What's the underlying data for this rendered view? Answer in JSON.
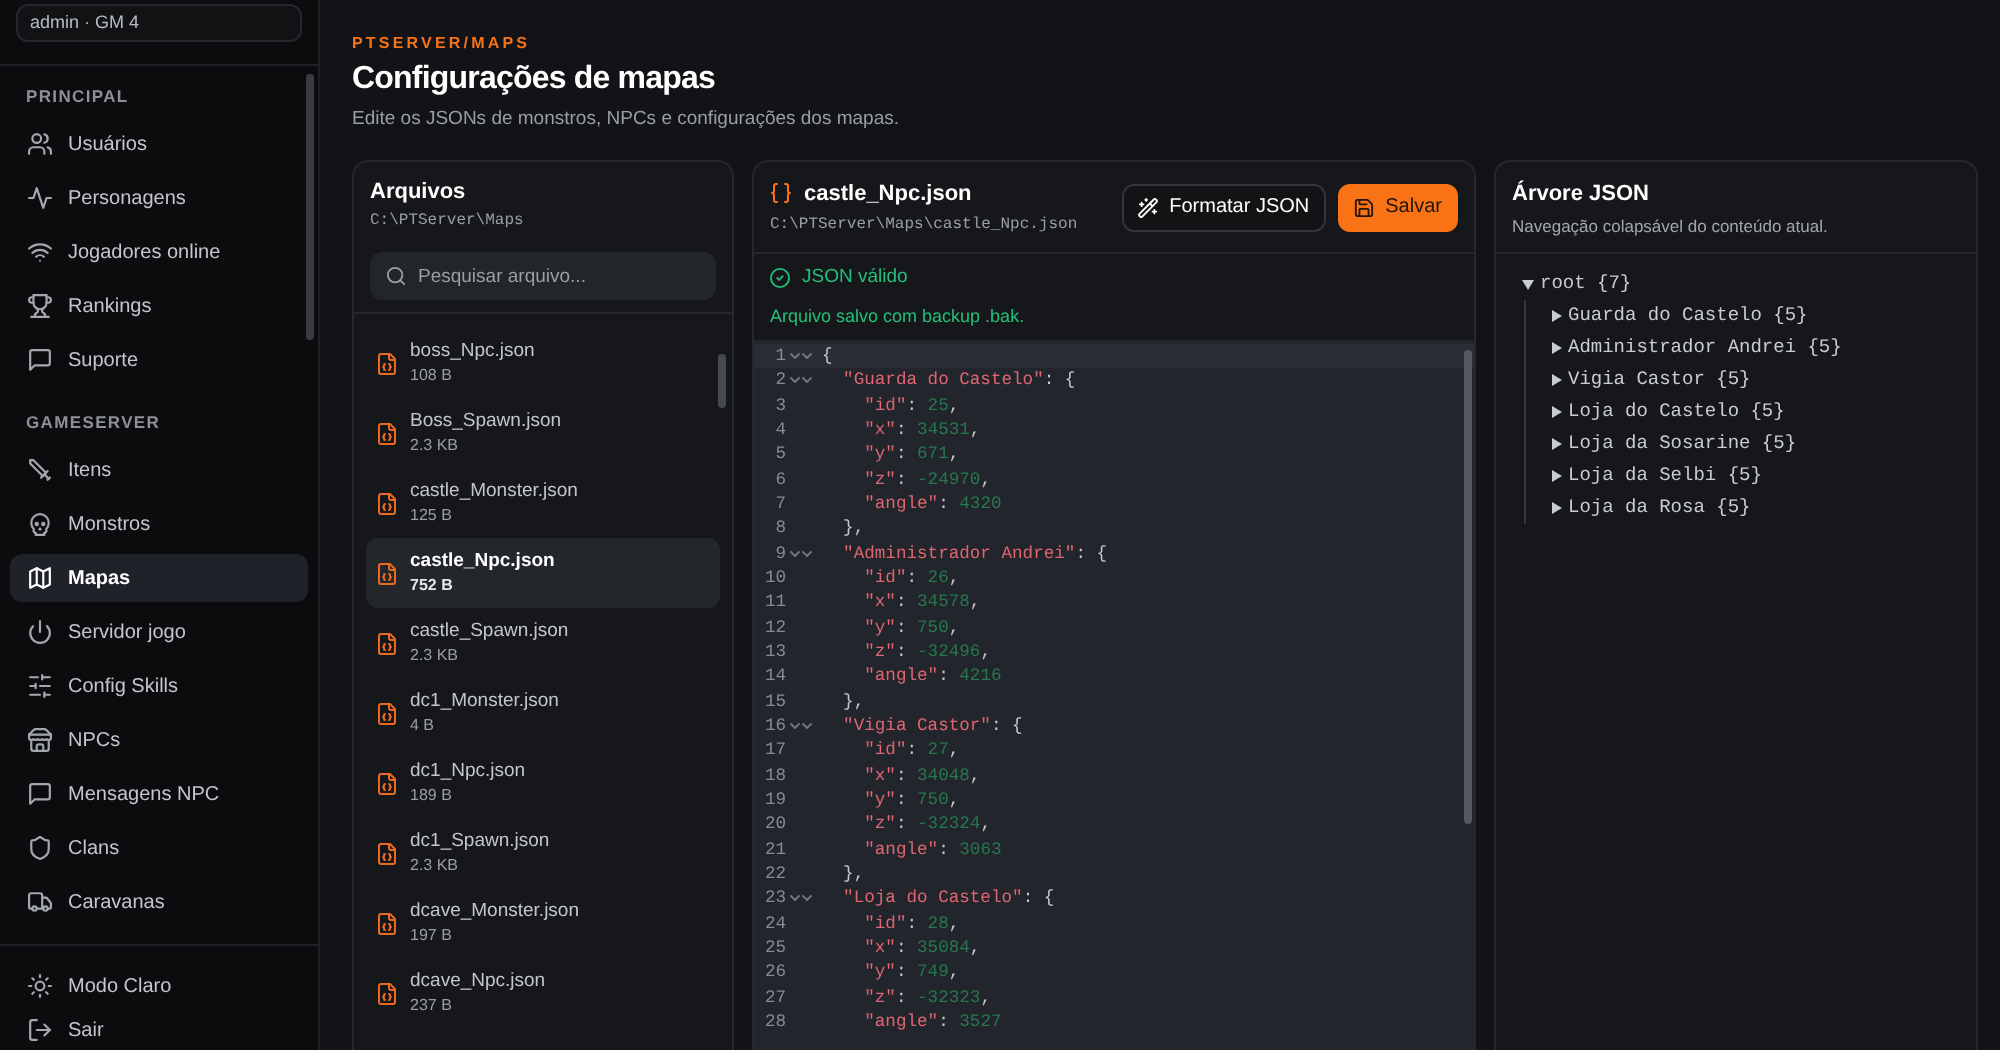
{
  "sidebar": {
    "account": "admin · GM 4",
    "sections": [
      {
        "title": "PRINCIPAL",
        "items": [
          {
            "label": "Usuários",
            "selected": false
          },
          {
            "label": "Personagens",
            "selected": false
          },
          {
            "label": "Jogadores online",
            "selected": false
          },
          {
            "label": "Rankings",
            "selected": false
          },
          {
            "label": "Suporte",
            "selected": false
          }
        ]
      },
      {
        "title": "GAMESERVER",
        "items": [
          {
            "label": "Itens",
            "selected": false
          },
          {
            "label": "Monstros",
            "selected": false
          },
          {
            "label": "Mapas",
            "selected": true
          },
          {
            "label": "Servidor jogo",
            "selected": false
          },
          {
            "label": "Config Skills",
            "selected": false
          },
          {
            "label": "NPCs",
            "selected": false
          },
          {
            "label": "Mensagens NPC",
            "selected": false
          },
          {
            "label": "Clans",
            "selected": false
          },
          {
            "label": "Caravanas",
            "selected": false
          }
        ]
      }
    ],
    "footer_items": [
      {
        "label": "Modo Claro"
      },
      {
        "label": "Sair"
      }
    ]
  },
  "header": {
    "breadcrumb": "PTSERVER/MAPS",
    "title": "Configurações de mapas",
    "subtitle": "Edite os JSONs de monstros, NPCs e configurações dos mapas."
  },
  "files": {
    "title": "Arquivos",
    "path": "C:\\PTServer\\Maps",
    "search": {
      "placeholder": "Pesquisar arquivo..."
    },
    "items": [
      {
        "name": "boss_Npc.json",
        "size": "108 B",
        "selected": false
      },
      {
        "name": "Boss_Spawn.json",
        "size": "2.3 KB",
        "selected": false
      },
      {
        "name": "castle_Monster.json",
        "size": "125 B",
        "selected": false
      },
      {
        "name": "castle_Npc.json",
        "size": "752 B",
        "selected": true
      },
      {
        "name": "castle_Spawn.json",
        "size": "2.3 KB",
        "selected": false
      },
      {
        "name": "dc1_Monster.json",
        "size": "4 B",
        "selected": false
      },
      {
        "name": "dc1_Npc.json",
        "size": "189 B",
        "selected": false
      },
      {
        "name": "dc1_Spawn.json",
        "size": "2.3 KB",
        "selected": false
      },
      {
        "name": "dcave_Monster.json",
        "size": "197 B",
        "selected": false
      },
      {
        "name": "dcave_Npc.json",
        "size": "237 B",
        "selected": false
      }
    ]
  },
  "editor": {
    "title": "castle_Npc.json",
    "path": "C:\\PTServer\\Maps\\castle_Npc.json",
    "buttons": [
      {
        "label": "Formatar JSON",
        "kind": "secondary"
      },
      {
        "label": "Salvar",
        "kind": "primary"
      }
    ],
    "validation": "JSON válido",
    "message": "Arquivo salvo com backup .bak.",
    "lines": [
      {
        "number": "1",
        "foldable": true,
        "active": true,
        "tokens": [
          {
            "kind": "punct",
            "text": "{"
          }
        ]
      },
      {
        "number": "2",
        "foldable": true,
        "active": false,
        "tokens": [
          {
            "kind": "key",
            "text": "  \"Guarda do Castelo\""
          },
          {
            "kind": "punct",
            "text": ": {"
          }
        ]
      },
      {
        "number": "3",
        "foldable": false,
        "active": false,
        "tokens": [
          {
            "kind": "key",
            "text": "    \"id\""
          },
          {
            "kind": "punct",
            "text": ": "
          },
          {
            "kind": "number",
            "text": "25"
          },
          {
            "kind": "punct",
            "text": ","
          }
        ]
      },
      {
        "number": "4",
        "foldable": false,
        "active": false,
        "tokens": [
          {
            "kind": "key",
            "text": "    \"x\""
          },
          {
            "kind": "punct",
            "text": ": "
          },
          {
            "kind": "number",
            "text": "34531"
          },
          {
            "kind": "punct",
            "text": ","
          }
        ]
      },
      {
        "number": "5",
        "foldable": false,
        "active": false,
        "tokens": [
          {
            "kind": "key",
            "text": "    \"y\""
          },
          {
            "kind": "punct",
            "text": ": "
          },
          {
            "kind": "number",
            "text": "671"
          },
          {
            "kind": "punct",
            "text": ","
          }
        ]
      },
      {
        "number": "6",
        "foldable": false,
        "active": false,
        "tokens": [
          {
            "kind": "key",
            "text": "    \"z\""
          },
          {
            "kind": "punct",
            "text": ": "
          },
          {
            "kind": "number",
            "text": "-24970"
          },
          {
            "kind": "punct",
            "text": ","
          }
        ]
      },
      {
        "number": "7",
        "foldable": false,
        "active": false,
        "tokens": [
          {
            "kind": "key",
            "text": "    \"angle\""
          },
          {
            "kind": "punct",
            "text": ": "
          },
          {
            "kind": "number",
            "text": "4320"
          }
        ]
      },
      {
        "number": "8",
        "foldable": false,
        "active": false,
        "tokens": [
          {
            "kind": "punct",
            "text": "  },"
          }
        ]
      },
      {
        "number": "9",
        "foldable": true,
        "active": false,
        "tokens": [
          {
            "kind": "key",
            "text": "  \"Administrador Andrei\""
          },
          {
            "kind": "punct",
            "text": ": {"
          }
        ]
      },
      {
        "number": "10",
        "foldable": false,
        "active": false,
        "tokens": [
          {
            "kind": "key",
            "text": "    \"id\""
          },
          {
            "kind": "punct",
            "text": ": "
          },
          {
            "kind": "number",
            "text": "26"
          },
          {
            "kind": "punct",
            "text": ","
          }
        ]
      },
      {
        "number": "11",
        "foldable": false,
        "active": false,
        "tokens": [
          {
            "kind": "key",
            "text": "    \"x\""
          },
          {
            "kind": "punct",
            "text": ": "
          },
          {
            "kind": "number",
            "text": "34578"
          },
          {
            "kind": "punct",
            "text": ","
          }
        ]
      },
      {
        "number": "12",
        "foldable": false,
        "active": false,
        "tokens": [
          {
            "kind": "key",
            "text": "    \"y\""
          },
          {
            "kind": "punct",
            "text": ": "
          },
          {
            "kind": "number",
            "text": "750"
          },
          {
            "kind": "punct",
            "text": ","
          }
        ]
      },
      {
        "number": "13",
        "foldable": false,
        "active": false,
        "tokens": [
          {
            "kind": "key",
            "text": "    \"z\""
          },
          {
            "kind": "punct",
            "text": ": "
          },
          {
            "kind": "number",
            "text": "-32496"
          },
          {
            "kind": "punct",
            "text": ","
          }
        ]
      },
      {
        "number": "14",
        "foldable": false,
        "active": false,
        "tokens": [
          {
            "kind": "key",
            "text": "    \"angle\""
          },
          {
            "kind": "punct",
            "text": ": "
          },
          {
            "kind": "number",
            "text": "4216"
          }
        ]
      },
      {
        "number": "15",
        "foldable": false,
        "active": false,
        "tokens": [
          {
            "kind": "punct",
            "text": "  },"
          }
        ]
      },
      {
        "number": "16",
        "foldable": true,
        "active": false,
        "tokens": [
          {
            "kind": "key",
            "text": "  \"Vigia Castor\""
          },
          {
            "kind": "punct",
            "text": ": {"
          }
        ]
      },
      {
        "number": "17",
        "foldable": false,
        "active": false,
        "tokens": [
          {
            "kind": "key",
            "text": "    \"id\""
          },
          {
            "kind": "punct",
            "text": ": "
          },
          {
            "kind": "number",
            "text": "27"
          },
          {
            "kind": "punct",
            "text": ","
          }
        ]
      },
      {
        "number": "18",
        "foldable": false,
        "active": false,
        "tokens": [
          {
            "kind": "key",
            "text": "    \"x\""
          },
          {
            "kind": "punct",
            "text": ": "
          },
          {
            "kind": "number",
            "text": "34048"
          },
          {
            "kind": "punct",
            "text": ","
          }
        ]
      },
      {
        "number": "19",
        "foldable": false,
        "active": false,
        "tokens": [
          {
            "kind": "key",
            "text": "    \"y\""
          },
          {
            "kind": "punct",
            "text": ": "
          },
          {
            "kind": "number",
            "text": "750"
          },
          {
            "kind": "punct",
            "text": ","
          }
        ]
      },
      {
        "number": "20",
        "foldable": false,
        "active": false,
        "tokens": [
          {
            "kind": "key",
            "text": "    \"z\""
          },
          {
            "kind": "punct",
            "text": ": "
          },
          {
            "kind": "number",
            "text": "-32324"
          },
          {
            "kind": "punct",
            "text": ","
          }
        ]
      },
      {
        "number": "21",
        "foldable": false,
        "active": false,
        "tokens": [
          {
            "kind": "key",
            "text": "    \"angle\""
          },
          {
            "kind": "punct",
            "text": ": "
          },
          {
            "kind": "number",
            "text": "3063"
          }
        ]
      },
      {
        "number": "22",
        "foldable": false,
        "active": false,
        "tokens": [
          {
            "kind": "punct",
            "text": "  },"
          }
        ]
      },
      {
        "number": "23",
        "foldable": true,
        "active": false,
        "tokens": [
          {
            "kind": "key",
            "text": "  \"Loja do Castelo\""
          },
          {
            "kind": "punct",
            "text": ": {"
          }
        ]
      },
      {
        "number": "24",
        "foldable": false,
        "active": false,
        "tokens": [
          {
            "kind": "key",
            "text": "    \"id\""
          },
          {
            "kind": "punct",
            "text": ": "
          },
          {
            "kind": "number",
            "text": "28"
          },
          {
            "kind": "punct",
            "text": ","
          }
        ]
      },
      {
        "number": "25",
        "foldable": false,
        "active": false,
        "tokens": [
          {
            "kind": "key",
            "text": "    \"x\""
          },
          {
            "kind": "punct",
            "text": ": "
          },
          {
            "kind": "number",
            "text": "35084"
          },
          {
            "kind": "punct",
            "text": ","
          }
        ]
      },
      {
        "number": "26",
        "foldable": false,
        "active": false,
        "tokens": [
          {
            "kind": "key",
            "text": "    \"y\""
          },
          {
            "kind": "punct",
            "text": ": "
          },
          {
            "kind": "number",
            "text": "749"
          },
          {
            "kind": "punct",
            "text": ","
          }
        ]
      },
      {
        "number": "27",
        "foldable": false,
        "active": false,
        "tokens": [
          {
            "kind": "key",
            "text": "    \"z\""
          },
          {
            "kind": "punct",
            "text": ": "
          },
          {
            "kind": "number",
            "text": "-32323"
          },
          {
            "kind": "punct",
            "text": ","
          }
        ]
      },
      {
        "number": "28",
        "foldable": false,
        "active": false,
        "tokens": [
          {
            "kind": "key",
            "text": "    \"angle\""
          },
          {
            "kind": "punct",
            "text": ": "
          },
          {
            "kind": "number",
            "text": "3527"
          }
        ]
      }
    ]
  },
  "tree": {
    "title": "Árvore JSON",
    "subtitle": "Navegação colapsável do conteúdo atual.",
    "root": {
      "label": "root {7}",
      "expanded": true,
      "children": [
        {
          "label": "Guarda do Castelo {5}",
          "expanded": false
        },
        {
          "label": "Administrador Andrei {5}",
          "expanded": false
        },
        {
          "label": "Vigia Castor {5}",
          "expanded": false
        },
        {
          "label": "Loja do Castelo {5}",
          "expanded": false
        },
        {
          "label": "Loja da Sosarine {5}",
          "expanded": false
        },
        {
          "label": "Loja da Selbi {5}",
          "expanded": false
        },
        {
          "label": "Loja da Rosa {5}",
          "expanded": false
        }
      ]
    }
  }
}
